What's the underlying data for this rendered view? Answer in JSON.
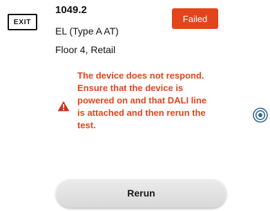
{
  "device": {
    "icon_label": "EXIT",
    "id": "1049.2",
    "type": "EL (Type A AT)",
    "location": "Floor 4, Retail"
  },
  "status": {
    "label": "Failed",
    "color": "#e2451c"
  },
  "error": {
    "message": "The device does not respond.\nEnsure that the device is\npowered on and that DALI line\nis attached and then rerun the\ntest.",
    "icon": "warning-icon"
  },
  "side_icon": "locate-target-icon",
  "actions": {
    "rerun_label": "Rerun"
  }
}
